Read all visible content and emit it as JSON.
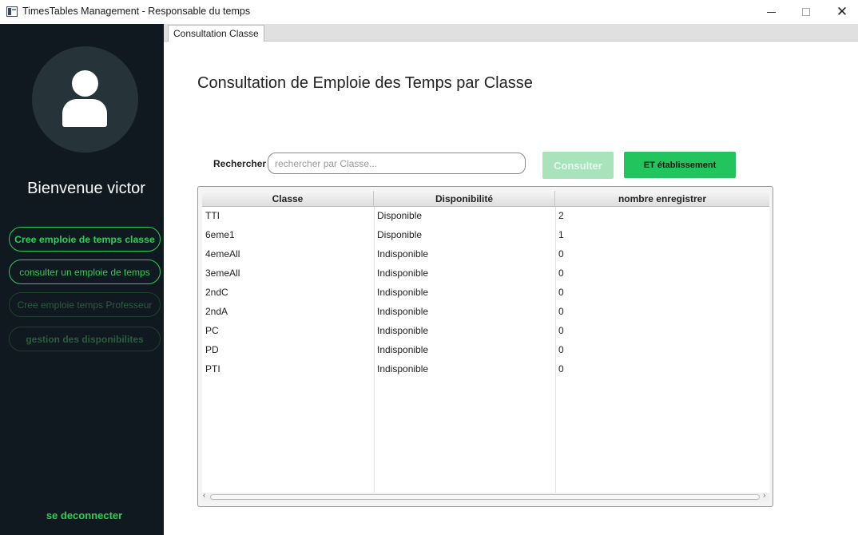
{
  "window": {
    "title": "TimesTables Management - Responsable du temps"
  },
  "sidebar": {
    "welcome": "Bienvenue victor",
    "buttons": [
      "Cree emploie de temps classe",
      "consulter un emploie de temps",
      "Cree emploie temps Professeur",
      "gestion des disponibilites"
    ],
    "logout": "se deconnecter"
  },
  "tabs": [
    "Consultation Classe"
  ],
  "main": {
    "title": "Consultation de Emploie des Temps par Classe",
    "search_label": "Rechercher",
    "search_placeholder": "rechercher par Classe...",
    "search_value": "",
    "consult_button": "Consulter",
    "etab_button": "ET établissement"
  },
  "table": {
    "columns": [
      "Classe",
      "Disponibilité",
      "nombre enregistrer"
    ],
    "rows": [
      [
        "TTI",
        "Disponible",
        "2"
      ],
      [
        "6eme1",
        "Disponible",
        "1"
      ],
      [
        "4emeAll",
        "Indisponible",
        "0"
      ],
      [
        "3emeAll",
        "Indisponible",
        "0"
      ],
      [
        "2ndC",
        "Indisponible",
        "0"
      ],
      [
        "2ndA",
        "Indisponible",
        "0"
      ],
      [
        "PC",
        "Indisponible",
        "0"
      ],
      [
        "PD",
        "Indisponible",
        "0"
      ],
      [
        "PTI",
        "Indisponible",
        "0"
      ]
    ]
  },
  "colors": {
    "accent": "#22c45e",
    "sidebar_bg": "#0f191f"
  }
}
